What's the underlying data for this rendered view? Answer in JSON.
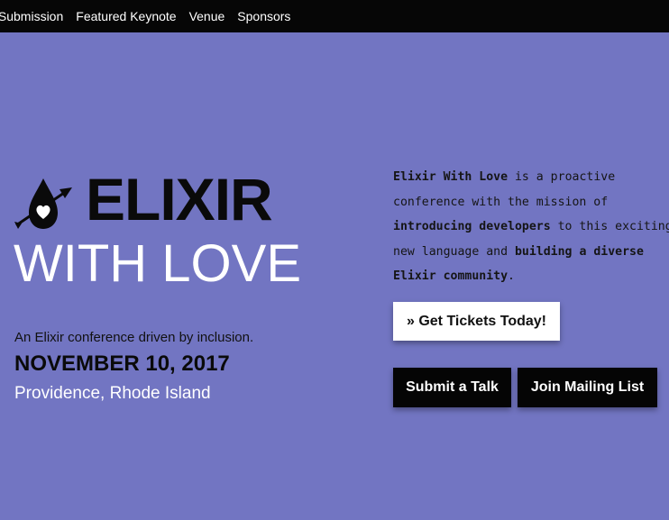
{
  "nav": {
    "items": [
      {
        "label": "k Submission"
      },
      {
        "label": "Featured Keynote"
      },
      {
        "label": "Venue"
      },
      {
        "label": "Sponsors"
      }
    ]
  },
  "hero": {
    "logo_line1": "ELIXIR",
    "logo_line2": "WITH LOVE",
    "tagline": "An Elixir conference driven by inclusion.",
    "date": "NOVEMBER 10, 2017",
    "location": "Providence, Rhode Island"
  },
  "about": {
    "p1_bold": "Elixir With Love",
    "p2": " is a proactive conference with the mission of ",
    "p3_bold": "introducing developers",
    "p4": " to this exciting new language and ",
    "p5_bold": "building a diverse Elixir community",
    "p6": "."
  },
  "buttons": {
    "tickets": "» Get Tickets Today!",
    "submit": "Submit a Talk",
    "mailing": "Join Mailing List"
  },
  "icons": {
    "logo": "elixir-drop-arrow-heart-icon"
  },
  "colors": {
    "background": "#7275c2",
    "nav_bg": "#060606",
    "button_dark": "#050505",
    "button_light": "#ffffff"
  }
}
